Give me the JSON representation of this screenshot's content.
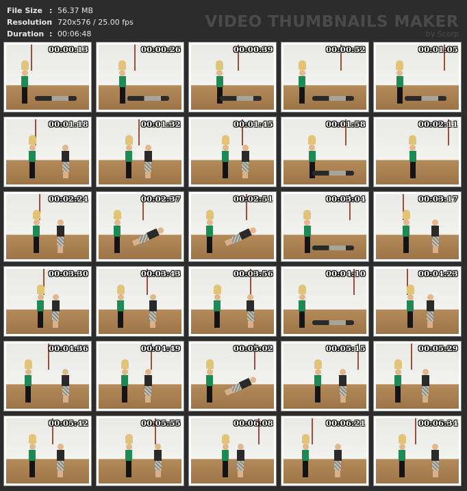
{
  "info": {
    "file_size_label": "File Size",
    "file_size_value": "56.37 MB",
    "resolution_label": "Resolution",
    "resolution_value": "720x576 / 25.00 fps",
    "duration_label": "Duration",
    "duration_value": "00:06:48",
    "separator": ":"
  },
  "brand": {
    "title": "VIDEO THUMBNAILS MAKER",
    "subtitle": "by Scorp"
  },
  "thumbnails": [
    {
      "time": "00:00:13"
    },
    {
      "time": "00:00:26"
    },
    {
      "time": "00:00:39"
    },
    {
      "time": "00:00:52"
    },
    {
      "time": "00:01:05"
    },
    {
      "time": "00:01:18"
    },
    {
      "time": "00:01:32"
    },
    {
      "time": "00:01:45"
    },
    {
      "time": "00:01:58"
    },
    {
      "time": "00:02:11"
    },
    {
      "time": "00:02:24"
    },
    {
      "time": "00:02:37"
    },
    {
      "time": "00:02:51"
    },
    {
      "time": "00:03:04"
    },
    {
      "time": "00:03:17"
    },
    {
      "time": "00:03:30"
    },
    {
      "time": "00:03:43"
    },
    {
      "time": "00:03:56"
    },
    {
      "time": "00:04:10"
    },
    {
      "time": "00:04:23"
    },
    {
      "time": "00:04:36"
    },
    {
      "time": "00:04:49"
    },
    {
      "time": "00:05:02"
    },
    {
      "time": "00:05:15"
    },
    {
      "time": "00:05:29"
    },
    {
      "time": "00:05:42"
    },
    {
      "time": "00:05:55"
    },
    {
      "time": "00:06:08"
    },
    {
      "time": "00:06:21"
    },
    {
      "time": "00:06:34"
    }
  ],
  "colors": {
    "background": "#2c2c2c",
    "meta_text": "#e6e6e6",
    "brand_text": "#4a4a4a",
    "stamp_text": "#ffffff"
  }
}
